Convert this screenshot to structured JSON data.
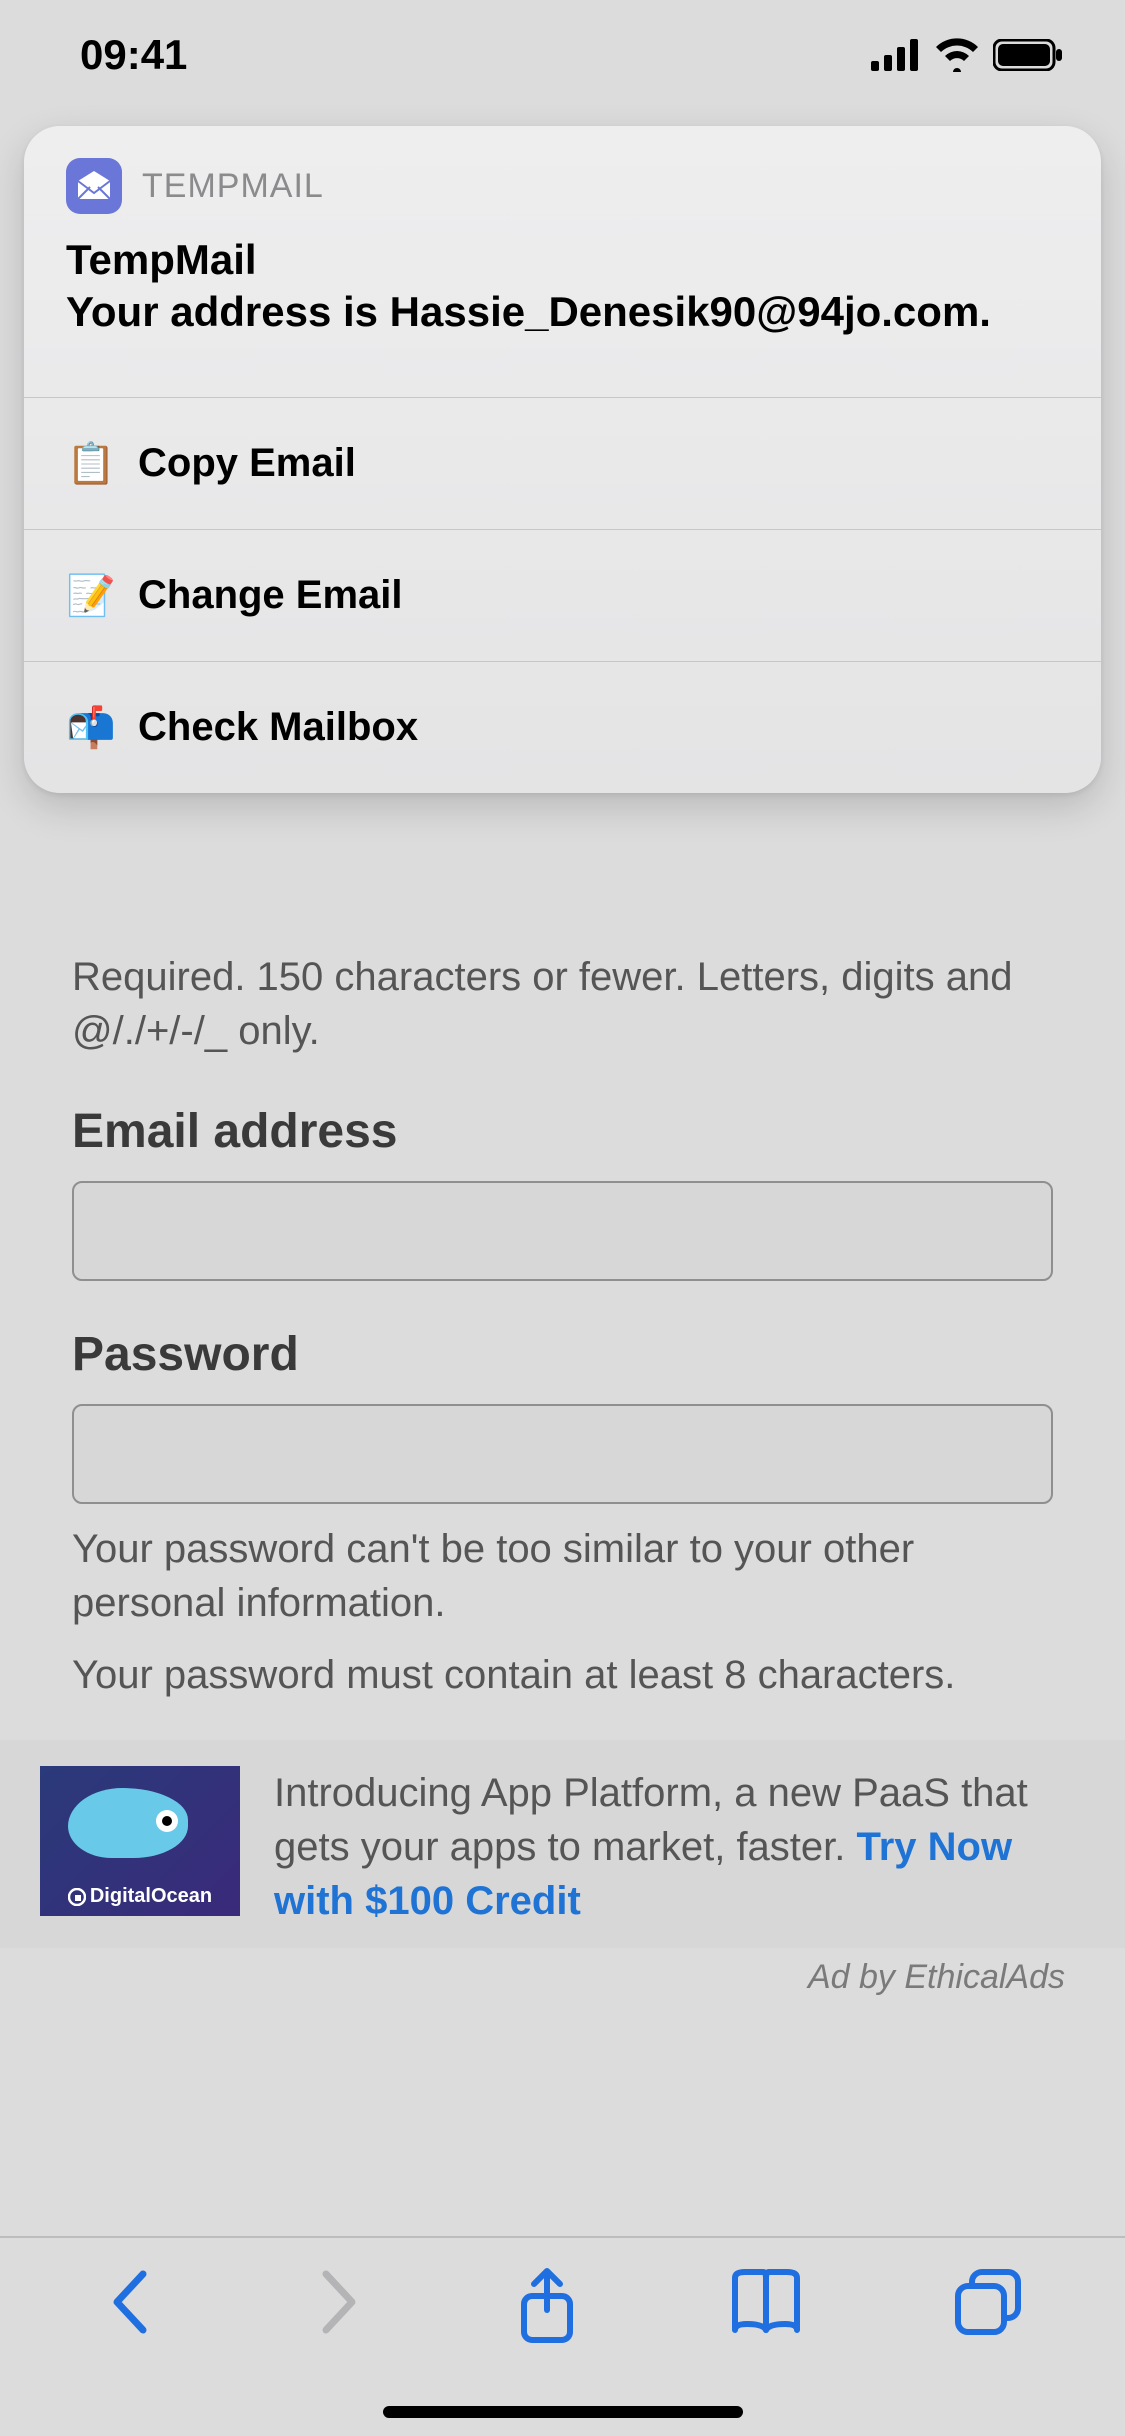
{
  "status_bar": {
    "time": "09:41"
  },
  "banner": {
    "app_name": "TEMPMAIL",
    "title": "TempMail",
    "message": "Your address is Hassie_Denesik90@94jo.com.",
    "actions": {
      "copy": {
        "icon": "📋",
        "label": "Copy Email"
      },
      "change": {
        "icon": "📝",
        "label": "Change Email"
      },
      "check": {
        "icon": "📬",
        "label": "Check Mailbox"
      }
    }
  },
  "form": {
    "username_help": "Required. 150 characters or fewer. Letters, digits and @/./+/-/_ only.",
    "email_label": "Email address",
    "email_value": "",
    "password_label": "Password",
    "password_value": "",
    "password_help1": "Your password can't be too similar to your other personal information.",
    "password_help2": "Your password must contain at least 8 characters."
  },
  "ad": {
    "brand": "DigitalOcean",
    "copy_prefix": "Introducing App Platform, a new PaaS that gets your apps to market, faster. ",
    "cta": "Try Now with $100 Credit",
    "attribution": "Ad by EthicalAds"
  }
}
